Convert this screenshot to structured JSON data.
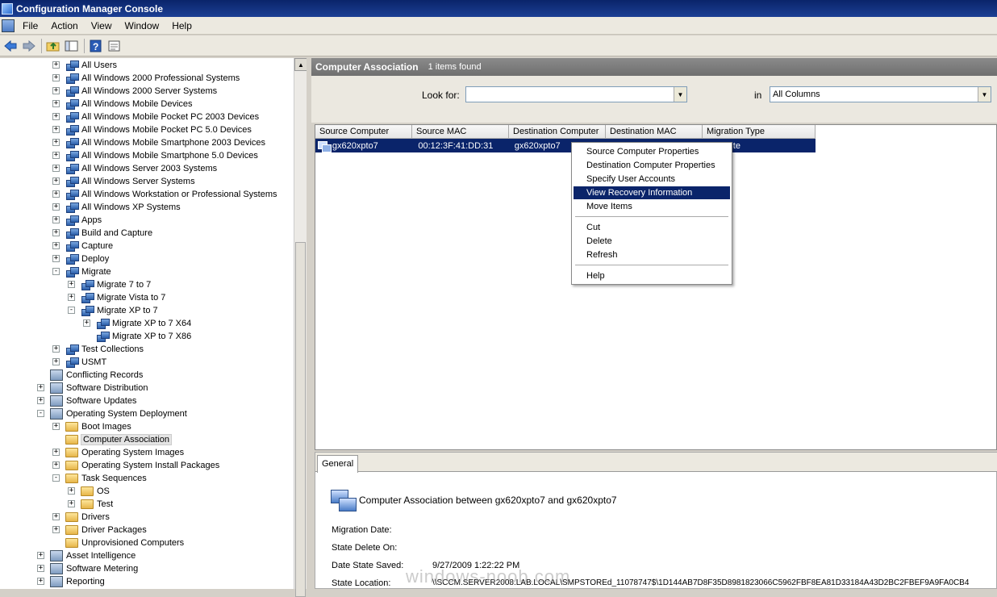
{
  "window": {
    "title": "Configuration Manager Console"
  },
  "menu": {
    "items": [
      "File",
      "Action",
      "View",
      "Window",
      "Help"
    ]
  },
  "toolbar": {
    "icons": [
      "back-arrow-icon",
      "forward-arrow-icon",
      "up-folder-icon",
      "show-hide-tree-icon",
      "help-icon",
      "properties-icon"
    ]
  },
  "tree": {
    "nodes": [
      {
        "label": "All Users",
        "type": "collection",
        "level": 3,
        "expander": "+"
      },
      {
        "label": "All Windows 2000 Professional Systems",
        "type": "collection",
        "level": 3,
        "expander": "+"
      },
      {
        "label": "All Windows 2000 Server Systems",
        "type": "collection",
        "level": 3,
        "expander": "+"
      },
      {
        "label": "All Windows Mobile Devices",
        "type": "collection",
        "level": 3,
        "expander": "+"
      },
      {
        "label": "All Windows Mobile Pocket PC 2003 Devices",
        "type": "collection",
        "level": 3,
        "expander": "+"
      },
      {
        "label": "All Windows Mobile Pocket PC 5.0 Devices",
        "type": "collection",
        "level": 3,
        "expander": "+"
      },
      {
        "label": "All Windows Mobile Smartphone 2003 Devices",
        "type": "collection",
        "level": 3,
        "expander": "+"
      },
      {
        "label": "All Windows Mobile Smartphone 5.0 Devices",
        "type": "collection",
        "level": 3,
        "expander": "+"
      },
      {
        "label": "All Windows Server 2003 Systems",
        "type": "collection",
        "level": 3,
        "expander": "+"
      },
      {
        "label": "All Windows Server Systems",
        "type": "collection",
        "level": 3,
        "expander": "+"
      },
      {
        "label": "All Windows Workstation or Professional Systems",
        "type": "collection",
        "level": 3,
        "expander": "+"
      },
      {
        "label": "All Windows XP Systems",
        "type": "collection",
        "level": 3,
        "expander": "+"
      },
      {
        "label": "Apps",
        "type": "collection",
        "level": 3,
        "expander": "+"
      },
      {
        "label": "Build and Capture",
        "type": "collection",
        "level": 3,
        "expander": "+"
      },
      {
        "label": "Capture",
        "type": "collection",
        "level": 3,
        "expander": "+"
      },
      {
        "label": "Deploy",
        "type": "collection",
        "level": 3,
        "expander": "+"
      },
      {
        "label": "Migrate",
        "type": "collection",
        "level": 3,
        "expander": "-"
      },
      {
        "label": "Migrate 7 to 7",
        "type": "collection",
        "level": 4,
        "expander": "+"
      },
      {
        "label": "Migrate Vista to 7",
        "type": "collection",
        "level": 4,
        "expander": "+"
      },
      {
        "label": "Migrate XP to 7",
        "type": "collection",
        "level": 4,
        "expander": "-"
      },
      {
        "label": "Migrate XP to 7 X64",
        "type": "collection",
        "level": 5,
        "expander": "+"
      },
      {
        "label": "Migrate XP to 7 X86",
        "type": "collection",
        "level": 5,
        "expander": ""
      },
      {
        "label": "Test Collections",
        "type": "collection",
        "level": 3,
        "expander": "+"
      },
      {
        "label": "USMT",
        "type": "collection",
        "level": 3,
        "expander": "+"
      },
      {
        "label": "Conflicting Records",
        "type": "generic",
        "level": 2,
        "expander": ""
      },
      {
        "label": "Software Distribution",
        "type": "generic",
        "level": 2,
        "expander": "+"
      },
      {
        "label": "Software Updates",
        "type": "generic",
        "level": 2,
        "expander": "+"
      },
      {
        "label": "Operating System Deployment",
        "type": "generic",
        "level": 2,
        "expander": "-"
      },
      {
        "label": "Boot Images",
        "type": "folder",
        "level": 3,
        "expander": "+"
      },
      {
        "label": "Computer Association",
        "type": "folder",
        "level": 3,
        "expander": "",
        "selected": true
      },
      {
        "label": "Operating System Images",
        "type": "folder",
        "level": 3,
        "expander": "+"
      },
      {
        "label": "Operating System Install Packages",
        "type": "folder",
        "level": 3,
        "expander": "+"
      },
      {
        "label": "Task Sequences",
        "type": "folder",
        "level": 3,
        "expander": "-"
      },
      {
        "label": "OS",
        "type": "folder",
        "level": 4,
        "expander": "+"
      },
      {
        "label": "Test",
        "type": "folder",
        "level": 4,
        "expander": "+"
      },
      {
        "label": "Drivers",
        "type": "folder",
        "level": 3,
        "expander": "+"
      },
      {
        "label": "Driver Packages",
        "type": "folder",
        "level": 3,
        "expander": "+"
      },
      {
        "label": "Unprovisioned Computers",
        "type": "folder",
        "level": 3,
        "expander": ""
      },
      {
        "label": "Asset Intelligence",
        "type": "generic",
        "level": 2,
        "expander": "+"
      },
      {
        "label": "Software Metering",
        "type": "generic",
        "level": 2,
        "expander": "+"
      },
      {
        "label": "Reporting",
        "type": "generic",
        "level": 2,
        "expander": "+"
      }
    ]
  },
  "results": {
    "title": "Computer Association",
    "count": "1 items found",
    "look_for_label": "Look for:",
    "look_for_value": "",
    "in_label": "in",
    "in_value": "All Columns",
    "columns": [
      "Source Computer",
      "Source MAC",
      "Destination Computer",
      "Destination MAC",
      "Migration Type"
    ],
    "rows": [
      [
        "gx620xpto7",
        "00:12:3F:41:DD:31",
        "gx620xpto7",
        "",
        "...te"
      ]
    ]
  },
  "context_menu": {
    "items": [
      {
        "label": "Source Computer Properties"
      },
      {
        "label": "Destination Computer Properties"
      },
      {
        "label": "Specify User Accounts"
      },
      {
        "label": "View Recovery Information",
        "highlighted": true
      },
      {
        "label": "Move Items"
      },
      {
        "label": "Cut"
      },
      {
        "label": "Delete"
      },
      {
        "label": "Refresh"
      },
      {
        "label": "Help"
      }
    ]
  },
  "details": {
    "tab": "General",
    "heading": "Computer Association between gx620xpto7 and gx620xpto7",
    "props": [
      {
        "label": "Migration Date:",
        "value": ""
      },
      {
        "label": "State Delete On:",
        "value": ""
      },
      {
        "label": "Date State Saved:",
        "value": "9/27/2009 1:22:22 PM"
      },
      {
        "label": "State Location:",
        "value": "\\\\SCCM.SERVER2008.LAB.LOCAL\\SMPSTOREd_11078747$\\1D144AB7D8F35D8981823066C5962FBF8EA81D33184A43D2BC2FBEF9A9FA0CB4"
      }
    ]
  },
  "watermark": "windows-noob.com"
}
